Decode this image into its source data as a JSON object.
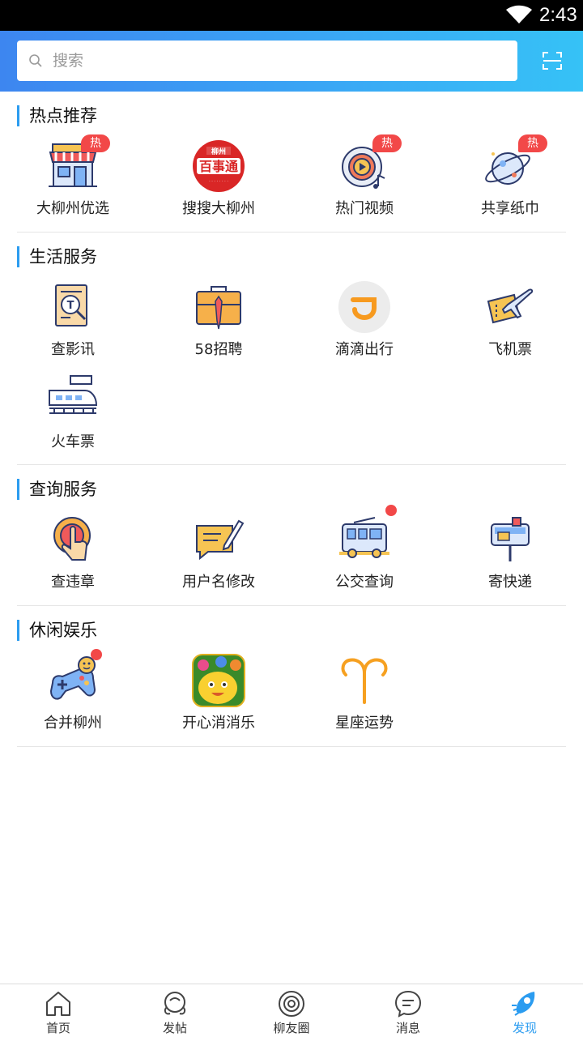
{
  "status_bar": {
    "time": "2:43"
  },
  "search": {
    "placeholder": "搜索"
  },
  "sections": {
    "hot": {
      "title": "热点推荐",
      "items": [
        {
          "label": "大柳州优选",
          "icon": "storefront-icon",
          "badge": "热"
        },
        {
          "label": "搜搜大柳州",
          "icon": "baishitong-logo-icon",
          "logo_text": "柳州 百事通"
        },
        {
          "label": "热门视频",
          "icon": "video-disc-icon",
          "badge": "热"
        },
        {
          "label": "共享纸巾",
          "icon": "planet-icon",
          "badge": "热"
        }
      ]
    },
    "life": {
      "title": "生活服务",
      "items": [
        {
          "label": "查影讯",
          "icon": "movie-search-icon"
        },
        {
          "label": "58招聘",
          "icon": "briefcase-icon"
        },
        {
          "label": "滴滴出行",
          "icon": "didi-icon"
        },
        {
          "label": "飞机票",
          "icon": "plane-ticket-icon"
        },
        {
          "label": "火车票",
          "icon": "train-icon"
        }
      ]
    },
    "query": {
      "title": "查询服务",
      "items": [
        {
          "label": "查违章",
          "icon": "hand-button-icon"
        },
        {
          "label": "用户名修改",
          "icon": "edit-message-icon"
        },
        {
          "label": "公交查询",
          "icon": "bus-icon",
          "dot": true
        },
        {
          "label": "寄快递",
          "icon": "mailbox-icon"
        }
      ]
    },
    "fun": {
      "title": "休闲娱乐",
      "items": [
        {
          "label": "合并柳州",
          "icon": "gamepad-icon",
          "dot": true
        },
        {
          "label": "开心消消乐",
          "icon": "happy-elimination-icon"
        },
        {
          "label": "星座运势",
          "icon": "aries-icon"
        }
      ]
    }
  },
  "bottom_nav": {
    "items": [
      {
        "label": "首页",
        "icon": "home-icon"
      },
      {
        "label": "发帖",
        "icon": "post-icon"
      },
      {
        "label": "柳友圈",
        "icon": "circle-icon"
      },
      {
        "label": "消息",
        "icon": "message-icon"
      },
      {
        "label": "发现",
        "icon": "rocket-icon",
        "active": true
      }
    ]
  },
  "colors": {
    "accent": "#2b9cf0",
    "badge": "#f24848",
    "header_start": "#3d86f0",
    "header_end": "#36c2f6"
  }
}
